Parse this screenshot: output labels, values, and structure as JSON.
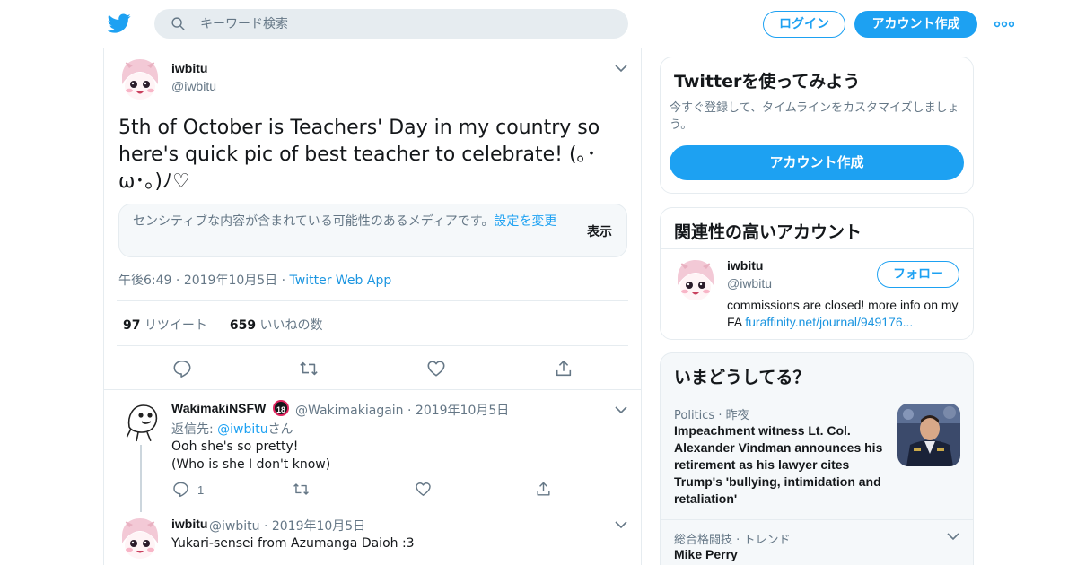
{
  "colors": {
    "accent": "#1da1f2",
    "text": "#14171a",
    "muted": "#657786",
    "border": "#e6ecf0"
  },
  "topbar": {
    "logo_icon": "twitter-bird-icon",
    "search_placeholder": "キーワード検索",
    "login_label": "ログイン",
    "signup_label": "アカウント作成",
    "more_icon": "more-dots-icon"
  },
  "tweet": {
    "name": "iwbitu",
    "handle": "@iwbitu",
    "text": "5th of October is  Teachers' Day in my country so here's quick pic of best teacher to celebrate! (｡･ω･｡)ﾉ♡",
    "sensitive": {
      "message": "センシティブな内容が含まれている可能性のあるメディアです。",
      "settings_link": "設定を変更",
      "show_label": "表示"
    },
    "time": "午後6:49",
    "date": "2019年10月5日",
    "source": "Twitter Web App",
    "retweets": "97",
    "retweets_label": "リツイート",
    "likes": "659",
    "likes_label": "いいねの数"
  },
  "replies": [
    {
      "name": "WakimakiNSFW",
      "badge": "18",
      "handle": "@Wakimakiagain",
      "date": "2019年10月5日",
      "reply_to_label": "返信先:",
      "reply_to_handle": "@iwbitu",
      "reply_to_suffix": "さん",
      "text": "Ooh she's so pretty!\n(Who is she I don't know)",
      "reply_count": "1"
    },
    {
      "name": "iwbitu",
      "handle": "@iwbitu",
      "date": "2019年10月5日",
      "text": "Yukari-sensei from Azumanga Daioh :3"
    }
  ],
  "sidebar": {
    "signup_card": {
      "title": "Twitterを使ってみよう",
      "description": "今すぐ登録して、タイムラインをカスタマイズしましょう。",
      "button": "アカウント作成"
    },
    "related": {
      "title": "関連性の高いアカウント",
      "name": "iwbitu",
      "handle": "@iwbitu",
      "follow": "フォロー",
      "bio": "commissions are closed! more info on my FA",
      "bio_link": "furaffinity.net/journal/949176..."
    },
    "trends": {
      "title": "いまどうしてる？",
      "item1_category": "Politics",
      "item1_time": "昨夜",
      "item1_headline": "Impeachment witness Lt. Col. Alexander Vindman announces his retirement as his lawyer cites Trump's 'bullying, intimidation and retaliation'",
      "item2_category": "総合格闘技",
      "item2_label": "トレンド",
      "item2_name": "Mike Perry"
    }
  }
}
